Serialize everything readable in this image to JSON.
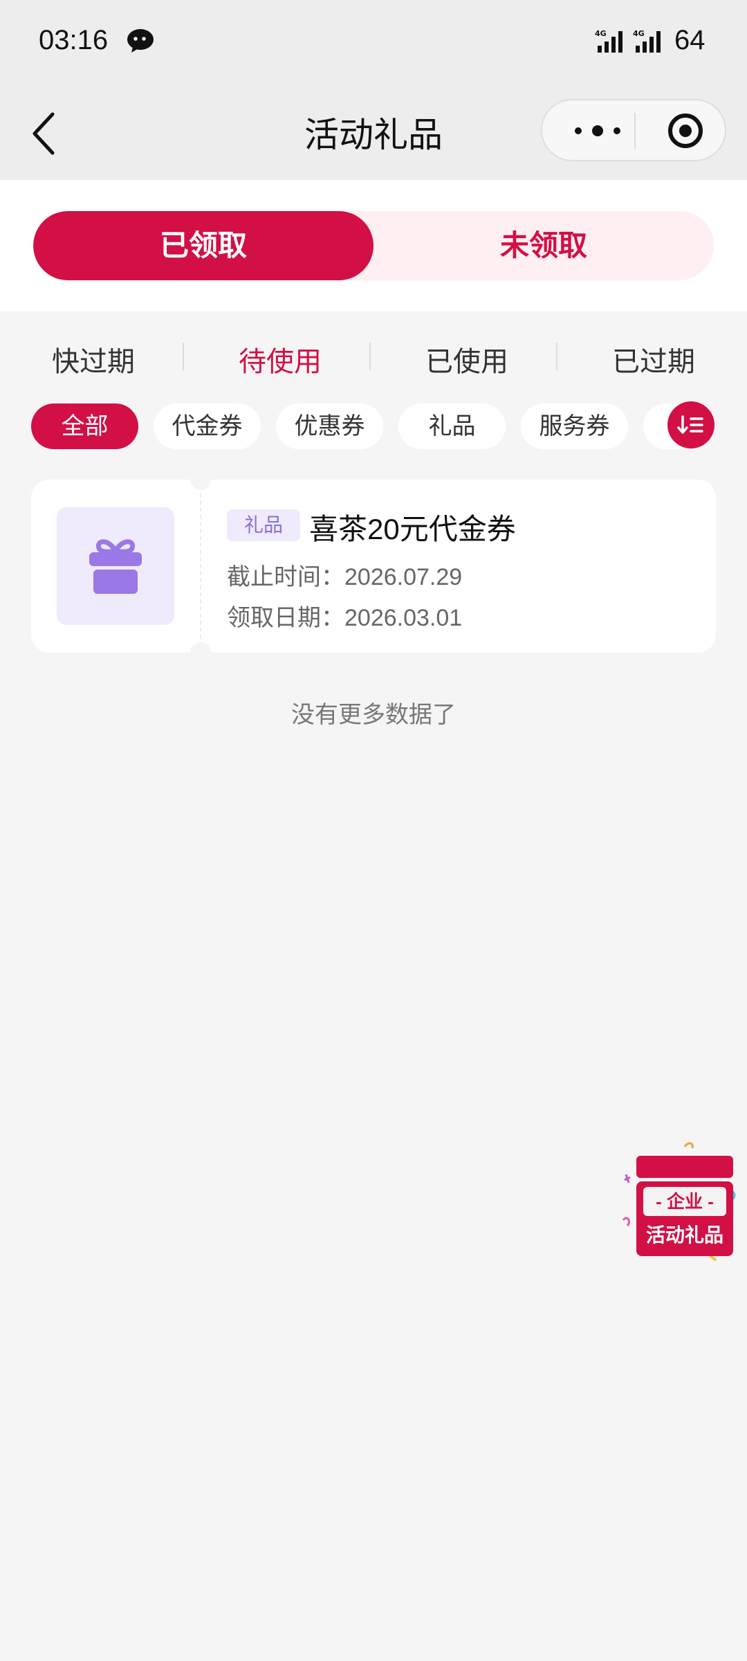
{
  "status_bar": {
    "time": "03:16",
    "battery": "64",
    "icons": [
      "wechat-icon",
      "signal-4g-icon",
      "signal-4g-icon"
    ]
  },
  "nav": {
    "title": "活动礼品",
    "icons": [
      "back-chevron-icon",
      "more-dots-icon",
      "target-circle-icon"
    ]
  },
  "segment": {
    "items": [
      "已领取",
      "未领取"
    ],
    "active_index": 0
  },
  "status_tabs": {
    "items": [
      "快过期",
      "待使用",
      "已使用",
      "已过期"
    ],
    "active_index": 1
  },
  "category_chips": {
    "items": [
      "全部",
      "代金券",
      "优惠券",
      "礼品",
      "服务券"
    ],
    "active_index": 0,
    "sort_icon": "sort-desc-icon"
  },
  "coupon": {
    "tag": "礼品",
    "title": "喜茶20元代金券",
    "deadline_label": "截止时间：",
    "deadline_value": "2026.07.29",
    "received_label": "领取日期：",
    "received_value": "2026.03.01",
    "thumb_icon": "gift-box-icon"
  },
  "list_footer": "没有更多数据了",
  "floating_badge": {
    "band": "- 企业 -",
    "label": "活动礼品"
  },
  "colors": {
    "accent": "#d21045",
    "accent_light": "#fdeff2",
    "gift_purple": "#9a78e6",
    "gift_bg": "#efeafc",
    "page_bg": "#f5f5f5"
  }
}
